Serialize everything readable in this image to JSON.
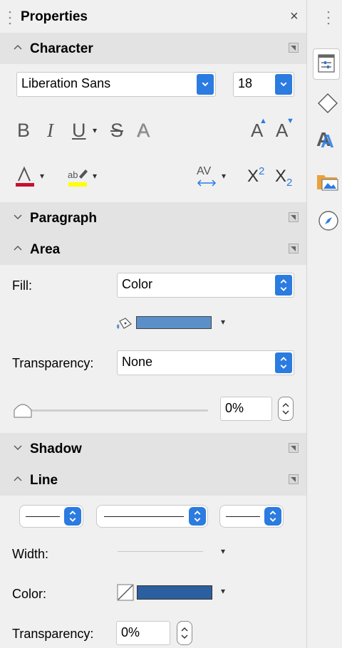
{
  "panel": {
    "title": "Properties",
    "close_glyph": "×"
  },
  "character": {
    "header": "Character",
    "font_name": "Liberation Sans",
    "font_size": "18",
    "bold": "B",
    "italic": "I",
    "underline": "U",
    "strike": "S",
    "shadow": "A",
    "grow": "A",
    "shrink": "A",
    "superscript_base": "X",
    "superscript_exp": "2",
    "subscript_base": "X",
    "subscript_exp": "2",
    "spacing": "AV"
  },
  "paragraph": {
    "header": "Paragraph"
  },
  "area": {
    "header": "Area",
    "fill_label": "Fill:",
    "fill_value": "Color",
    "fill_color": "#5b8fc9",
    "transparency_label": "Transparency:",
    "transparency_value": "None",
    "transparency_percent": "0%",
    "slider_fraction": 0
  },
  "shadow": {
    "header": "Shadow"
  },
  "line": {
    "header": "Line",
    "width_label": "Width:",
    "color_label": "Color:",
    "color_value": "#2b5fa0",
    "transparency_label": "Transparency:",
    "transparency_value": "0%"
  },
  "colors": {
    "accent": "#2b7be0",
    "font_color": "#c8102e",
    "highlight": "#ffff00"
  },
  "tabs": [
    "properties-tab-icon",
    "shapes-tab-icon",
    "styles-tab-icon",
    "gallery-tab-icon",
    "navigator-tab-icon"
  ]
}
